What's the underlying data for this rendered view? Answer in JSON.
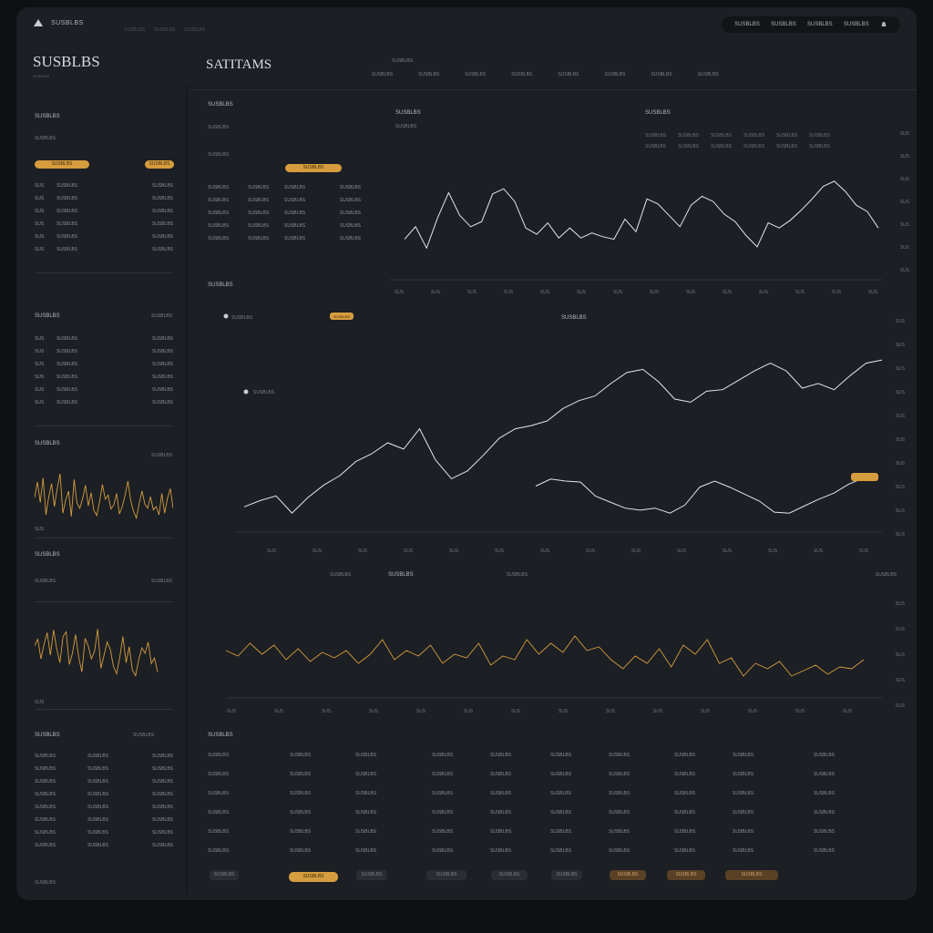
{
  "app": {
    "name": "SUSBLBS",
    "crumbs": [
      "SUSBLBS",
      "SUSBLBS",
      "SUSBLBS"
    ],
    "nav": [
      "SUSBLBS",
      "SUSBLBS",
      "SUSBLBS",
      "SUSBLBS"
    ],
    "brand_title": "SUSBLBS",
    "brand_sub": "SUSBLBS",
    "main_title": "SATITAMS",
    "main_sub": "SUSBLBS"
  },
  "header_tabs": [
    "SUSBLBS",
    "SUSBLBS",
    "SUSBLBS",
    "SUSBLBS",
    "SUSBLBS",
    "SUSBLBS",
    "SUSBLBS",
    "SUSBLBS"
  ],
  "left": {
    "panel1": {
      "title": "SUSBLBS",
      "subtitle": "SUSBLBS",
      "pill_primary": "SUSBLBS",
      "pill_secondary": "SUSBLBS",
      "rows": [
        [
          "SUS",
          "SUSBLBS",
          "SUSBLBS"
        ],
        [
          "SUS",
          "SUSBLBS",
          "SUSBLBS"
        ],
        [
          "SUS",
          "SUSBLBS",
          "SUSBLBS"
        ],
        [
          "SUS",
          "SUSBLBS",
          "SUSBLBS"
        ],
        [
          "SUS",
          "SUSBLBS",
          "SUSBLBS"
        ],
        [
          "SUS",
          "SUSBLBS",
          "SUSBLBS"
        ]
      ]
    },
    "panel2": {
      "title": "SUSBLBS",
      "right": "SUSBLBS",
      "rows": [
        [
          "SUS",
          "SUSBLBS",
          "SUSBLBS"
        ],
        [
          "SUS",
          "SUSBLBS",
          "SUSBLBS"
        ],
        [
          "SUS",
          "SUSBLBS",
          "SUSBLBS"
        ],
        [
          "SUS",
          "SUSBLBS",
          "SUSBLBS"
        ],
        [
          "SUS",
          "SUSBLBS",
          "SUSBLBS"
        ],
        [
          "SUS",
          "SUSBLBS",
          "SUSBLBS"
        ]
      ]
    },
    "chart1": {
      "title": "SUSBLBS",
      "right": "SUSBLBS",
      "x_label": "SUS",
      "series": [
        41,
        60,
        35,
        65,
        20,
        42,
        58,
        30,
        52,
        70,
        22,
        38,
        49,
        18,
        63,
        34,
        28,
        40,
        56,
        31,
        47,
        25,
        19,
        36,
        57,
        39,
        44,
        27,
        32,
        46,
        21,
        30,
        44,
        61,
        37,
        24,
        16,
        34,
        49,
        33,
        28,
        42,
        26,
        30,
        20,
        46,
        22,
        40,
        52,
        28
      ]
    },
    "chart2": {
      "title": "SUSBLBS",
      "sub": "SUSBLBS",
      "right": "SUSBLBS",
      "x_label": "SUS",
      "series": [
        48,
        55,
        34,
        50,
        62,
        38,
        65,
        45,
        30,
        58,
        63,
        28,
        40,
        60,
        35,
        20,
        56,
        48,
        34,
        42,
        66,
        24,
        38,
        52,
        44,
        26,
        18,
        36,
        58,
        30,
        47,
        22,
        16,
        33,
        46,
        40,
        52,
        29,
        35,
        20
      ]
    },
    "bottom_table": {
      "title": "SUSBLBS",
      "right": "SUSBLBS",
      "rows": [
        [
          "SUSBLBS",
          "SUSBLBS",
          "SUSBLBS"
        ],
        [
          "SUSBLBS",
          "SUSBLBS",
          "SUSBLBS"
        ],
        [
          "SUSBLBS",
          "SUSBLBS",
          "SUSBLBS"
        ],
        [
          "SUSBLBS",
          "SUSBLBS",
          "SUSBLBS"
        ],
        [
          "SUSBLBS",
          "SUSBLBS",
          "SUSBLBS"
        ],
        [
          "SUSBLBS",
          "SUSBLBS",
          "SUSBLBS"
        ],
        [
          "SUSBLBS",
          "SUSBLBS",
          "SUSBLBS"
        ],
        [
          "SUSBLBS",
          "SUSBLBS",
          "SUSBLBS"
        ]
      ],
      "footer": "SUSBLBS"
    }
  },
  "main": {
    "panel_a": {
      "title": "SUSBLBS",
      "sub": "SUSBLBS",
      "pill": "SUSBLBS",
      "table_label": "SUSBLBS",
      "rows": [
        [
          "SUSBLBS",
          "SUSBLBS",
          "SUSBLBS",
          "SUSBLBS"
        ],
        [
          "SUSBLBS",
          "SUSBLBS",
          "SUSBLBS",
          "SUSBLBS"
        ],
        [
          "SUSBLBS",
          "SUSBLBS",
          "SUSBLBS",
          "SUSBLBS"
        ],
        [
          "SUSBLBS",
          "SUSBLBS",
          "SUSBLBS",
          "SUSBLBS"
        ],
        [
          "SUSBLBS",
          "SUSBLBS",
          "SUSBLBS",
          "SUSBLBS"
        ]
      ]
    },
    "chart_top": {
      "title": "SUSBLBS",
      "sub": "SUSBLBS",
      "legend_title": "SUSBLBS",
      "legend_items": [
        "SUSBLBS",
        "SUSBLBS",
        "SUSBLBS",
        "SUSBLBS",
        "SUSBLBS",
        "SUSBLBS",
        "SUSBLBS",
        "SUSBLBS",
        "SUSBLBS",
        "SUSBLBS",
        "SUSBLBS",
        "SUSBLBS"
      ],
      "y_ticks": [
        "SUS",
        "SUS",
        "SUS",
        "SUS",
        "SUS",
        "SUS",
        "SUS"
      ],
      "x_ticks": [
        "SUS",
        "SUS",
        "SUS",
        "SUS",
        "SUS",
        "SUS",
        "SUS",
        "SUS",
        "SUS",
        "SUS",
        "SUS",
        "SUS",
        "SUS",
        "SUS"
      ],
      "series": [
        0.39,
        0.49,
        0.32,
        0.56,
        0.76,
        0.58,
        0.49,
        0.53,
        0.75,
        0.79,
        0.69,
        0.48,
        0.43,
        0.52,
        0.4,
        0.48,
        0.4,
        0.44,
        0.41,
        0.39,
        0.55,
        0.45,
        0.71,
        0.67,
        0.58,
        0.49,
        0.66,
        0.73,
        0.69,
        0.59,
        0.53,
        0.42,
        0.33,
        0.52,
        0.48,
        0.54,
        0.62,
        0.71,
        0.81,
        0.85,
        0.77,
        0.66,
        0.61,
        0.48
      ]
    },
    "chart_mid": {
      "title": "SUSBLBS",
      "sub": "SUSBLBS",
      "legend": "SUSBLBS",
      "pill": "SUSBLBS",
      "marker_label": "SUSBLBS",
      "y_ticks": [
        "SUS",
        "SUS",
        "SUS",
        "SUS",
        "SUS",
        "SUS",
        "SUS",
        "SUS",
        "SUS",
        "SUS"
      ],
      "x_ticks": [
        "SUS",
        "SUS",
        "SUS",
        "SUS",
        "SUS",
        "SUS",
        "SUS",
        "SUS",
        "SUS",
        "SUS",
        "SUS",
        "SUS",
        "SUS",
        "SUS"
      ],
      "series_a": [
        0.08,
        0.12,
        0.15,
        0.04,
        0.14,
        0.22,
        0.28,
        0.37,
        0.42,
        0.49,
        0.45,
        0.58,
        0.38,
        0.26,
        0.31,
        0.41,
        0.52,
        0.58,
        0.6,
        0.63,
        0.71,
        0.76,
        0.79,
        0.87,
        0.94,
        0.96,
        0.88,
        0.77,
        0.75,
        0.82,
        0.83,
        0.89,
        0.95,
        1.0,
        0.95,
        0.84,
        0.87,
        0.83,
        0.92,
        1.0,
        1.02
      ],
      "series_b": [
        0.55,
        0.62,
        0.6,
        0.59,
        0.45,
        0.39,
        0.33,
        0.31,
        0.33,
        0.28,
        0.36,
        0.54,
        0.6,
        0.54,
        0.47,
        0.4,
        0.29,
        0.28,
        0.35,
        0.42,
        0.48,
        0.57,
        0.63
      ]
    },
    "chart_bottom": {
      "title": "SUSBLBS",
      "legend": "SUSBLBS",
      "right_label": "SUSBLBS",
      "marker_label": "SUSBLBS",
      "y_ticks": [
        "SUS",
        "SUS",
        "SUS",
        "SUS",
        "SUS"
      ],
      "x_ticks": [
        "SUS",
        "SUS",
        "SUS",
        "SUS",
        "SUS",
        "SUS",
        "SUS",
        "SUS",
        "SUS",
        "SUS",
        "SUS",
        "SUS",
        "SUS",
        "SUS"
      ],
      "series": [
        0.52,
        0.49,
        0.56,
        0.5,
        0.55,
        0.47,
        0.53,
        0.46,
        0.51,
        0.48,
        0.52,
        0.45,
        0.5,
        0.58,
        0.47,
        0.52,
        0.49,
        0.55,
        0.45,
        0.5,
        0.48,
        0.56,
        0.44,
        0.49,
        0.47,
        0.58,
        0.5,
        0.56,
        0.51,
        0.6,
        0.52,
        0.54,
        0.47,
        0.42,
        0.49,
        0.45,
        0.53,
        0.43,
        0.55,
        0.5,
        0.58,
        0.45,
        0.48,
        0.38,
        0.45,
        0.42,
        0.46,
        0.38,
        0.41,
        0.44,
        0.39,
        0.43,
        0.42,
        0.47
      ]
    },
    "bottom_table": {
      "title": "SUSBLBS",
      "rows": [
        [
          "SUSBLBS",
          "SUSBLBS",
          "SUSBLBS",
          "SUSBLBS",
          "SUSBLBS",
          "SUSBLBS",
          "SUSBLBS",
          "SUSBLBS",
          "SUSBLBS",
          "SUSBLBS"
        ],
        [
          "SUSBLBS",
          "SUSBLBS",
          "SUSBLBS",
          "SUSBLBS",
          "SUSBLBS",
          "SUSBLBS",
          "SUSBLBS",
          "SUSBLBS",
          "SUSBLBS",
          "SUSBLBS"
        ],
        [
          "SUSBLBS",
          "SUSBLBS",
          "SUSBLBS",
          "SUSBLBS",
          "SUSBLBS",
          "SUSBLBS",
          "SUSBLBS",
          "SUSBLBS",
          "SUSBLBS",
          "SUSBLBS"
        ],
        [
          "SUSBLBS",
          "SUSBLBS",
          "SUSBLBS",
          "SUSBLBS",
          "SUSBLBS",
          "SUSBLBS",
          "SUSBLBS",
          "SUSBLBS",
          "SUSBLBS",
          "SUSBLBS"
        ],
        [
          "SUSBLBS",
          "SUSBLBS",
          "SUSBLBS",
          "SUSBLBS",
          "SUSBLBS",
          "SUSBLBS",
          "SUSBLBS",
          "SUSBLBS",
          "SUSBLBS",
          "SUSBLBS"
        ],
        [
          "SUSBLBS",
          "SUSBLBS",
          "SUSBLBS",
          "SUSBLBS",
          "SUSBLBS",
          "SUSBLBS",
          "SUSBLBS",
          "SUSBLBS",
          "SUSBLBS",
          "SUSBLBS"
        ]
      ],
      "buttons": [
        "SUSBLBS",
        "SUSBLBS",
        "SUSBLBS",
        "SUSBLBS",
        "SUSBLBS",
        "SUSBLBS",
        "SUSBLBS",
        "SUSBLBS",
        "SUSBLBS"
      ]
    }
  },
  "colors": {
    "accent": "#d69d3e",
    "line_primary": "#e3e7eb",
    "line_secondary": "#d69d3e",
    "background": "#1c1f24"
  }
}
